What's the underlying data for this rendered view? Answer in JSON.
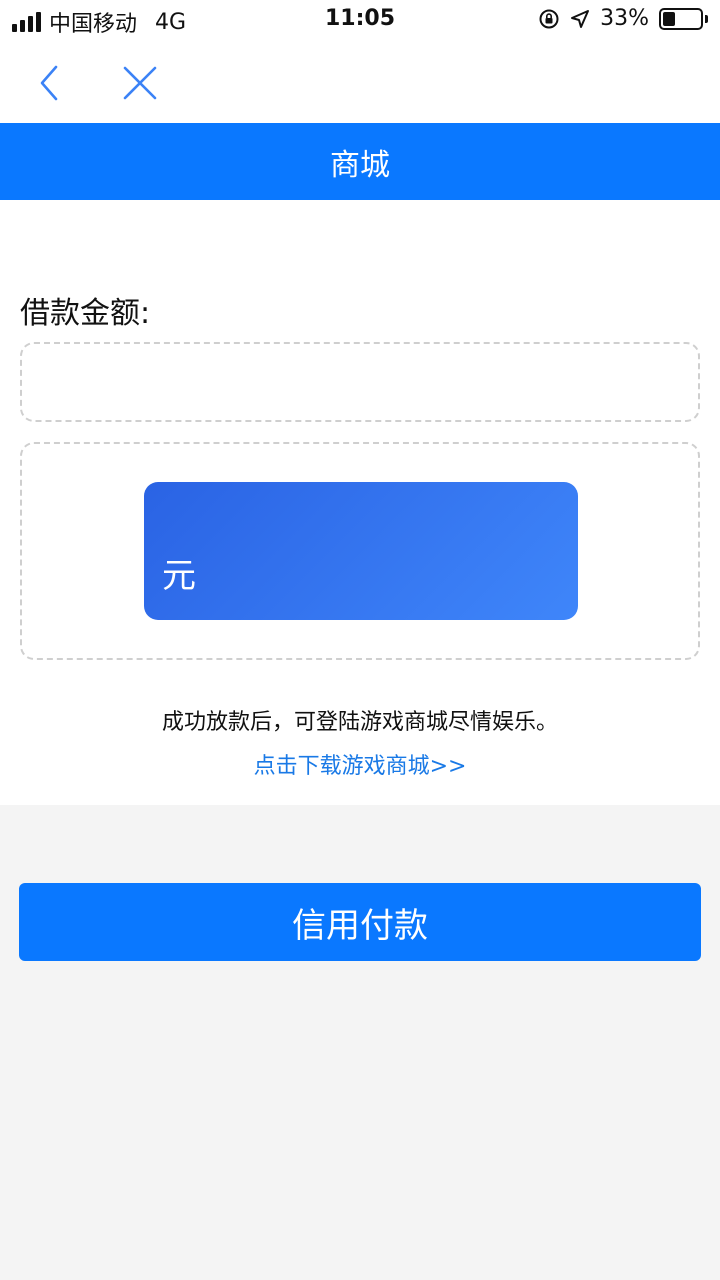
{
  "status_bar": {
    "carrier": "中国移动",
    "network": "4G",
    "time": "11:05",
    "battery_percent_text": "33%",
    "battery_level": 0.33,
    "icons": [
      "signal-icon",
      "rotation-lock-icon",
      "location-arrow-icon",
      "battery-icon"
    ]
  },
  "nav": {
    "back_icon": "chevron-left-icon",
    "close_icon": "close-icon",
    "accent_color": "#3b82f6"
  },
  "title_bar": {
    "title": "商城",
    "color": "#0a78ff"
  },
  "form": {
    "amount_label": "借款金额:",
    "amount_value": "",
    "card_unit": "元"
  },
  "notice": {
    "text": "成功放款后，可登陆游戏商城尽情娱乐。",
    "download_link": "点击下载游戏商城>>"
  },
  "actions": {
    "pay_button": "信用付款"
  }
}
